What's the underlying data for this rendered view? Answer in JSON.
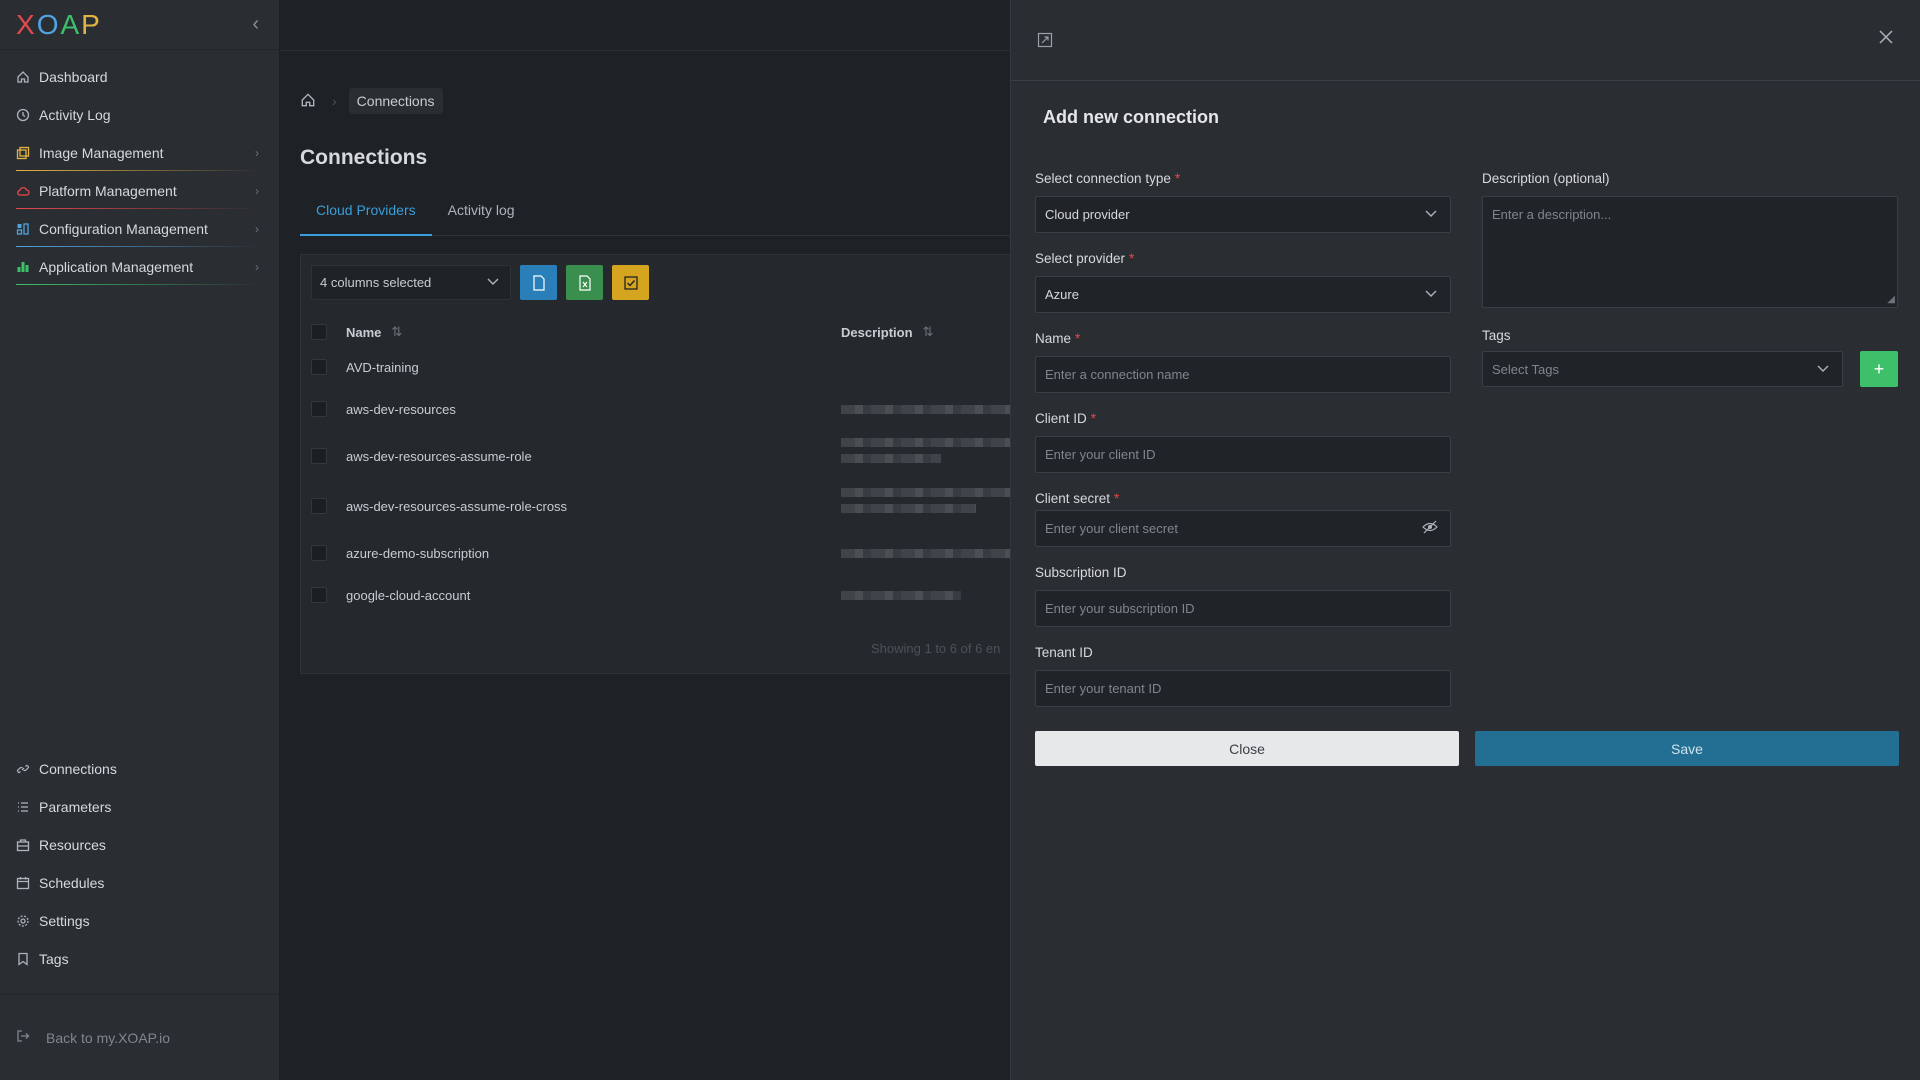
{
  "app": {
    "logo": [
      "X",
      "O",
      "A",
      "P"
    ],
    "logo_colors": [
      "#e5484d",
      "#4fa3e0",
      "#3ebf6a",
      "#e3b341"
    ]
  },
  "sidebar": {
    "items": [
      {
        "label": "Dashboard",
        "icon": "home-icon"
      },
      {
        "label": "Activity Log",
        "icon": "clock-icon"
      },
      {
        "label": "Image Management",
        "icon": "images-icon",
        "accent": "#e3b341"
      },
      {
        "label": "Platform Management",
        "icon": "cloud-icon",
        "accent": "#e5484d"
      },
      {
        "label": "Configuration Management",
        "icon": "config-icon",
        "accent": "#4fa3e0"
      },
      {
        "label": "Application Management",
        "icon": "apps-icon",
        "accent": "#3ebf6a"
      }
    ],
    "bottom_items": [
      {
        "label": "Connections",
        "icon": "link-icon"
      },
      {
        "label": "Parameters",
        "icon": "list-icon"
      },
      {
        "label": "Resources",
        "icon": "resources-icon"
      },
      {
        "label": "Schedules",
        "icon": "calendar-icon"
      },
      {
        "label": "Settings",
        "icon": "gear-icon"
      },
      {
        "label": "Tags",
        "icon": "bookmark-icon"
      }
    ],
    "footer": "Back to my.XOAP.io"
  },
  "main": {
    "breadcrumb": "Connections",
    "title": "Connections",
    "tabs": [
      {
        "label": "Cloud Providers",
        "active": true
      },
      {
        "label": "Activity log",
        "active": false
      }
    ],
    "columns_select": "4 columns selected",
    "toolbar_colors": [
      "#2a7fb8",
      "#3a8f4e",
      "#d5a520"
    ],
    "table": {
      "headers": [
        "Name",
        "Description"
      ],
      "rows": [
        {
          "name": "AVD-training"
        },
        {
          "name": "aws-dev-resources"
        },
        {
          "name": "aws-dev-resources-assume-role"
        },
        {
          "name": "aws-dev-resources-assume-role-cross"
        },
        {
          "name": "azure-demo-subscription"
        },
        {
          "name": "google-cloud-account"
        }
      ]
    },
    "footer": "Showing 1 to 6 of 6 en"
  },
  "drawer": {
    "title": "Add new connection",
    "connection_type": {
      "label": "Select connection type",
      "value": "Cloud provider"
    },
    "provider": {
      "label": "Select provider",
      "value": "Azure"
    },
    "name": {
      "label": "Name",
      "placeholder": "Enter a connection name"
    },
    "client_id": {
      "label": "Client ID",
      "placeholder": "Enter your client ID"
    },
    "client_secret": {
      "label": "Client secret",
      "placeholder": "Enter your client secret"
    },
    "subscription_id": {
      "label": "Subscription ID",
      "placeholder": "Enter your subscription ID"
    },
    "tenant_id": {
      "label": "Tenant ID",
      "placeholder": "Enter your tenant ID"
    },
    "description": {
      "label": "Description (optional)",
      "placeholder": "Enter a description..."
    },
    "tags": {
      "label": "Tags",
      "placeholder": "Select Tags"
    },
    "close_label": "Close",
    "save_label": "Save"
  }
}
